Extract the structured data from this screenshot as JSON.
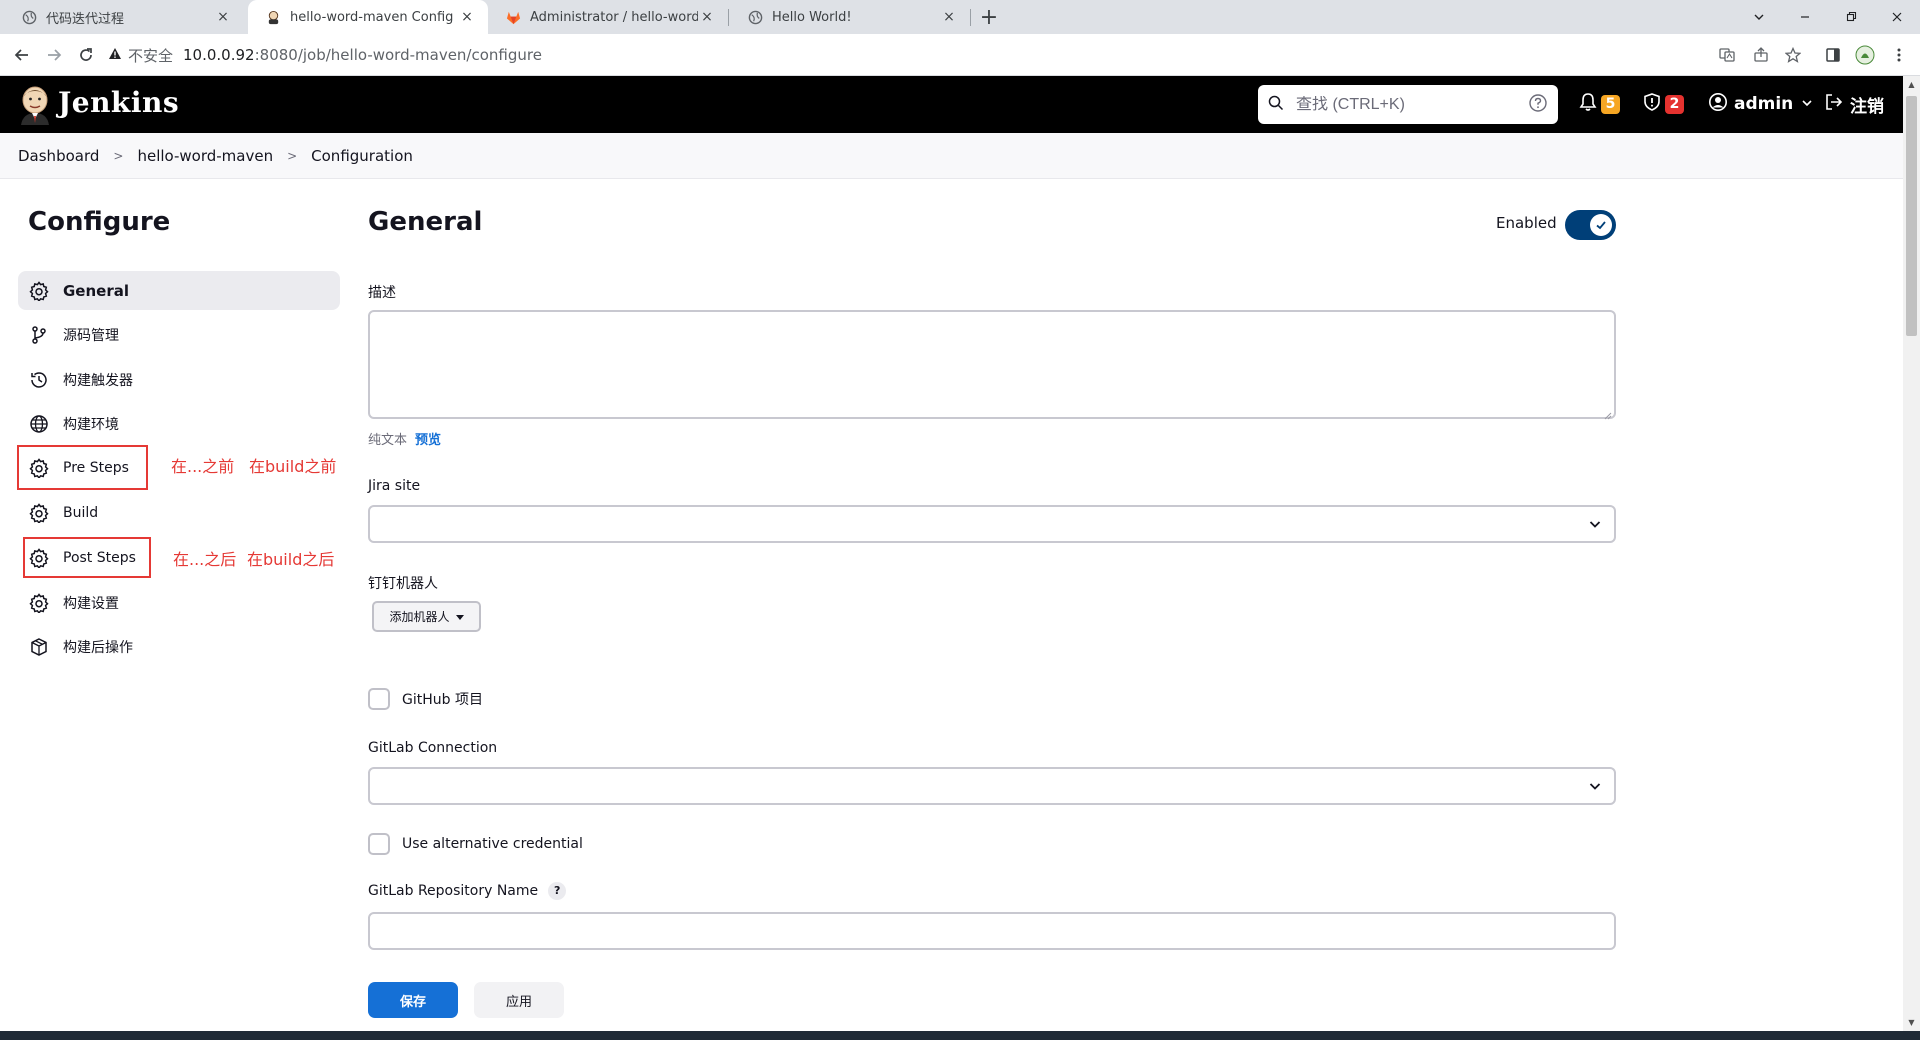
{
  "browser": {
    "tabs": [
      {
        "title": "代码迭代过程",
        "icon": "globe-icon",
        "active": false
      },
      {
        "title": "hello-word-maven Config [Jenkins]",
        "icon": "jenkins-icon",
        "active": true
      },
      {
        "title": "Administrator / hello-word · GitLab",
        "icon": "gitlab-icon",
        "active": false
      },
      {
        "title": "Hello World!",
        "icon": "globe-icon",
        "active": false
      }
    ],
    "close_glyph": "×",
    "newtab_glyph": "+",
    "address": {
      "security_label": "不安全",
      "host": "10.0.0.92",
      "path": ":8080/job/hello-word-maven/configure"
    }
  },
  "header": {
    "app_name": "Jenkins",
    "search_placeholder": "查找 (CTRL+K)",
    "notifications_count": "5",
    "security_count": "2",
    "user": "admin",
    "logout": "注销",
    "colors": {
      "notify_badge": "#f6a623",
      "security_badge": "#e5322f"
    }
  },
  "breadcrumb": {
    "items": [
      "Dashboard",
      "hello-word-maven",
      "Configuration"
    ],
    "separator": ">"
  },
  "sidebar": {
    "title": "Configure",
    "items": [
      {
        "label": "General",
        "icon": "gear-icon",
        "active": true
      },
      {
        "label": "源码管理",
        "icon": "branch-icon",
        "active": false
      },
      {
        "label": "构建触发器",
        "icon": "clock-icon",
        "active": false
      },
      {
        "label": "构建环境",
        "icon": "globe-icon",
        "active": false
      },
      {
        "label": "Pre Steps",
        "icon": "gear-icon",
        "active": false
      },
      {
        "label": "Build",
        "icon": "gear-icon",
        "active": false
      },
      {
        "label": "Post Steps",
        "icon": "gear-icon",
        "active": false
      },
      {
        "label": "构建设置",
        "icon": "gear-icon",
        "active": false
      },
      {
        "label": "构建后操作",
        "icon": "cube-icon",
        "active": false
      }
    ],
    "annotations": {
      "pre_a": "在...之前",
      "pre_b": "在build之前",
      "post_a": "在...之后",
      "post_b": "在build之后"
    }
  },
  "main": {
    "title": "General",
    "enabled_label": "Enabled",
    "enabled": true,
    "description_label": "描述",
    "format_text": "纯文本",
    "preview_link": "预览",
    "jira_label": "Jira site",
    "jira_value": "",
    "dingtalk_label": "钉钉机器人",
    "add_robot_button": "添加机器人",
    "github_project_label": "GitHub 项目",
    "gitlab_connection_label": "GitLab Connection",
    "gitlab_connection_value": "",
    "alt_credential_label": "Use alternative credential",
    "gitlab_repo_label": "GitLab Repository Name",
    "help_glyph": "?"
  },
  "actions": {
    "save": "保存",
    "apply": "应用"
  },
  "colors": {
    "primary": "#1570d6",
    "toggle": "#003f78",
    "annotation": "#e53935"
  }
}
